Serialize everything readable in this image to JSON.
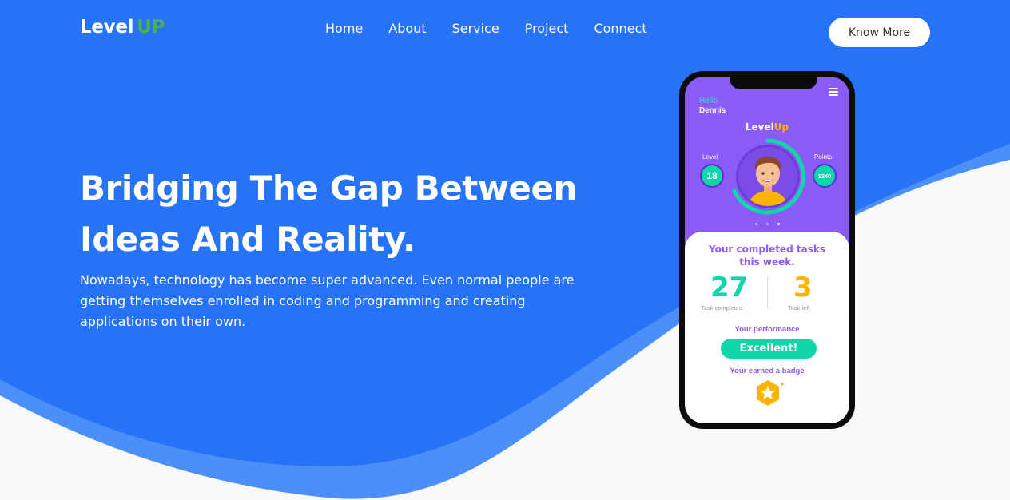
{
  "header": {
    "logo_main": "Level",
    "logo_accent": "UP",
    "nav": [
      "Home",
      "About",
      "Service",
      "Project",
      "Connect"
    ],
    "cta_label": "Know More"
  },
  "hero": {
    "title_line1": "Bridging The Gap Between",
    "title_line2": "Ideas And Reality.",
    "description": "Nowadays, technology has become super advanced. Even normal people are getting themselves enrolled in coding and programming and creating applications on their own."
  },
  "phone": {
    "greeting": "Hello",
    "user_name": "Dennis",
    "app_logo_main": "Level",
    "app_logo_accent": "Up",
    "level_label": "Level",
    "level_value": "18",
    "points_label": "Points",
    "points_value": "1340",
    "tasks_title_line1": "Your completed tasks",
    "tasks_title_line2": "this week.",
    "completed_value": "27",
    "completed_label": "Task completed",
    "left_value": "3",
    "left_label": "Task left",
    "performance_label": "Your performance",
    "performance_value": "Excellent!",
    "badge_label": "Your earned a badge"
  },
  "colors": {
    "primary": "#2673f7",
    "logo_accent": "#4caf50",
    "phone_purple": "#8a5cf5",
    "teal": "#10d6a9",
    "amber": "#ffb300"
  },
  "icons": [
    "menu-icon",
    "avatar-icon",
    "star-badge-icon"
  ]
}
